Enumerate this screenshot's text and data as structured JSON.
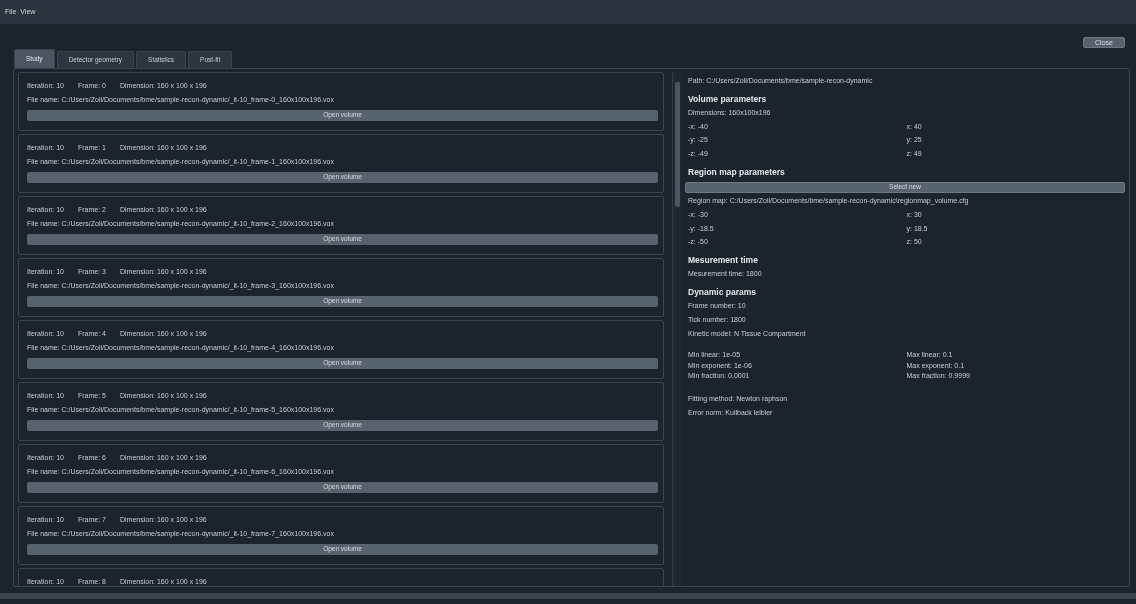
{
  "menu": [
    "File",
    "View"
  ],
  "close_button": "Close",
  "tabs": [
    {
      "label": "Study",
      "selected": true
    },
    {
      "label": "Detector geometry",
      "selected": false
    },
    {
      "label": "Statistics",
      "selected": false
    },
    {
      "label": "Post-fit",
      "selected": false
    }
  ],
  "frames": [
    {
      "iteration": "Iteration: 10",
      "frame": "Frame: 0",
      "dimension": "Dimension: 160 x 100 x 196",
      "file_name": "File name: C:/Users/Zoli/Documents/bme/sample-recon-dynamic/_it-10_frame-0_160x100x196.vox",
      "button": "Open volume"
    },
    {
      "iteration": "Iteration: 10",
      "frame": "Frame: 1",
      "dimension": "Dimension: 160 x 100 x 196",
      "file_name": "File name: C:/Users/Zoli/Documents/bme/sample-recon-dynamic/_it-10_frame-1_160x100x196.vox",
      "button": "Open volume"
    },
    {
      "iteration": "Iteration: 10",
      "frame": "Frame: 2",
      "dimension": "Dimension: 160 x 100 x 196",
      "file_name": "File name: C:/Users/Zoli/Documents/bme/sample-recon-dynamic/_it-10_frame-2_160x100x196.vox",
      "button": "Open volume"
    },
    {
      "iteration": "Iteration: 10",
      "frame": "Frame: 3",
      "dimension": "Dimension: 160 x 100 x 196",
      "file_name": "File name: C:/Users/Zoli/Documents/bme/sample-recon-dynamic/_it-10_frame-3_160x100x196.vox",
      "button": "Open volume"
    },
    {
      "iteration": "Iteration: 10",
      "frame": "Frame: 4",
      "dimension": "Dimension: 160 x 100 x 196",
      "file_name": "File name: C:/Users/Zoli/Documents/bme/sample-recon-dynamic/_it-10_frame-4_160x100x196.vox",
      "button": "Open volume"
    },
    {
      "iteration": "Iteration: 10",
      "frame": "Frame: 5",
      "dimension": "Dimension: 160 x 100 x 196",
      "file_name": "File name: C:/Users/Zoli/Documents/bme/sample-recon-dynamic/_it-10_frame-5_160x100x196.vox",
      "button": "Open volume"
    },
    {
      "iteration": "Iteration: 10",
      "frame": "Frame: 6",
      "dimension": "Dimension: 160 x 100 x 196",
      "file_name": "File name: C:/Users/Zoli/Documents/bme/sample-recon-dynamic/_it-10_frame-6_160x100x196.vox",
      "button": "Open volume"
    },
    {
      "iteration": "Iteration: 10",
      "frame": "Frame: 7",
      "dimension": "Dimension: 160 x 100 x 196",
      "file_name": "File name: C:/Users/Zoli/Documents/bme/sample-recon-dynamic/_it-10_frame-7_160x100x196.vox",
      "button": "Open volume"
    },
    {
      "iteration": "Iteration: 10",
      "frame": "Frame: 8",
      "dimension": "Dimension: 160 x 100 x 196"
    }
  ],
  "details": {
    "path": "Path: C:/Users/Zoli/Documents/bme/sample-recon-dynamic",
    "volume": {
      "title": "Volume parameters",
      "dimensions": "Dimensions: 160x100x196",
      "ranges": [
        {
          "min": "-x: -40",
          "max": "x: 40"
        },
        {
          "min": "-y: -25",
          "max": "y: 25"
        },
        {
          "min": "-z: -49",
          "max": "z: 49"
        }
      ]
    },
    "region_map": {
      "title": "Region map parameters",
      "button": "Select new",
      "map": "Region map: C:/Users/Zoli/Documents/bme/sample-recon-dynamic\\regionmap_volume.cfg",
      "ranges": [
        {
          "min": "-x: -30",
          "max": "x: 30"
        },
        {
          "min": "-y: -18.5",
          "max": "y: 18.5"
        },
        {
          "min": "-z: -50",
          "max": "z: 50"
        }
      ]
    },
    "measurement": {
      "title": "Mesurement time",
      "time": "Mesurement time: 1800"
    },
    "dynamic": {
      "title": "Dynamic params",
      "lines": [
        "Frame number: 10",
        "Tick number: 1800",
        "Kinetic model: N Tissue Compartment"
      ],
      "bounds": [
        {
          "min": "Min linear: 1e-05",
          "max": "Max linear: 0.1"
        },
        {
          "min": "Min exponent: 1e-06",
          "max": "Max exponent: 0.1"
        },
        {
          "min": "Min fraction: 0.0001",
          "max": "Max fraction: 0.9999"
        }
      ],
      "method_lines": [
        "Fitting method: Newton raphson",
        "Error norm: Kullback leibler"
      ]
    }
  }
}
